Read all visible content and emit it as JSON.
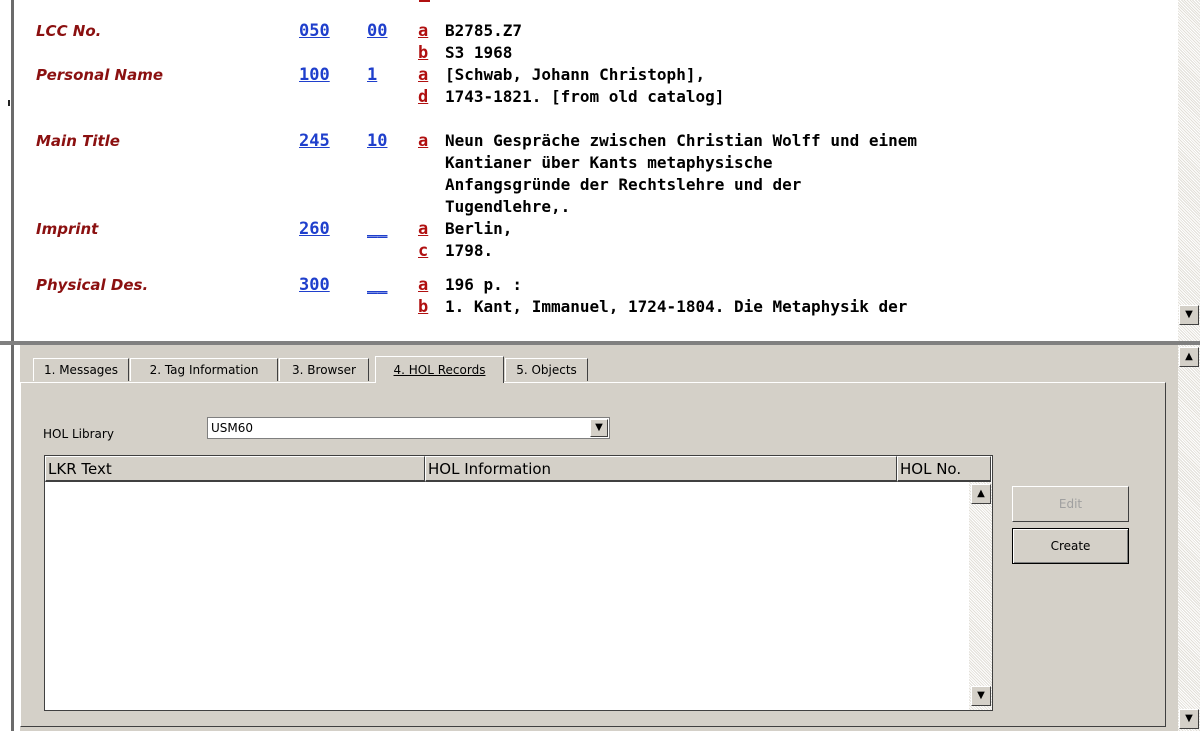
{
  "record": {
    "rows": [
      {
        "label": "LCC No.",
        "tag": "050",
        "ind": "00",
        "sub": "a",
        "text": "B2785.Z7"
      },
      {
        "label": "",
        "tag": "",
        "ind": "",
        "sub": "b",
        "text": "S3 1968"
      },
      {
        "label": "Personal Name",
        "tag": "100",
        "ind": "1",
        "sub": "a",
        "text": "[Schwab, Johann Christoph],"
      },
      {
        "label": "",
        "tag": "",
        "ind": "",
        "sub": "d",
        "text": "1743-1821. [from old catalog]"
      },
      {
        "label": "Main Title",
        "tag": "245",
        "ind": "10",
        "sub": "a",
        "text": "Neun Gespräche zwischen Christian Wolff und einem"
      },
      {
        "label": "",
        "tag": "",
        "ind": "",
        "sub": "",
        "text": "Kantianer über Kants metaphysische"
      },
      {
        "label": "",
        "tag": "",
        "ind": "",
        "sub": "",
        "text": "Anfangsgründe der Rechtslehre und der"
      },
      {
        "label": "",
        "tag": "",
        "ind": "",
        "sub": "",
        "text": "Tugendlehre,."
      },
      {
        "label": "Imprint",
        "tag": "260",
        "ind": "__",
        "sub": "a",
        "text": "Berlin,"
      },
      {
        "label": "",
        "tag": "",
        "ind": "",
        "sub": "c",
        "text": "1798."
      },
      {
        "label": "Physical Des.",
        "tag": "300",
        "ind": "__",
        "sub": "a",
        "text": "196 p. :"
      },
      {
        "label": "",
        "tag": "",
        "ind": "",
        "sub": "b",
        "text": "1. Kant, Immanuel, 1724-1804. Die Metaphysik der"
      }
    ]
  },
  "tabs": [
    {
      "label": "1. Messages"
    },
    {
      "label": "2. Tag Information"
    },
    {
      "label": "3. Browser"
    },
    {
      "label": "4. HOL Records",
      "active": true
    },
    {
      "label": "5. Objects"
    }
  ],
  "hol": {
    "library_label": "HOL Library",
    "library_value": "USM60",
    "columns": [
      "LKR Text",
      "HOL Information",
      "HOL No."
    ],
    "rows": [],
    "edit_label": "Edit",
    "create_label": "Create"
  },
  "icons": {
    "scroll_up": "scroll-up-arrow-icon",
    "scroll_down": "scroll-down-arrow-icon",
    "dropdown": "dropdown-arrow-icon"
  }
}
